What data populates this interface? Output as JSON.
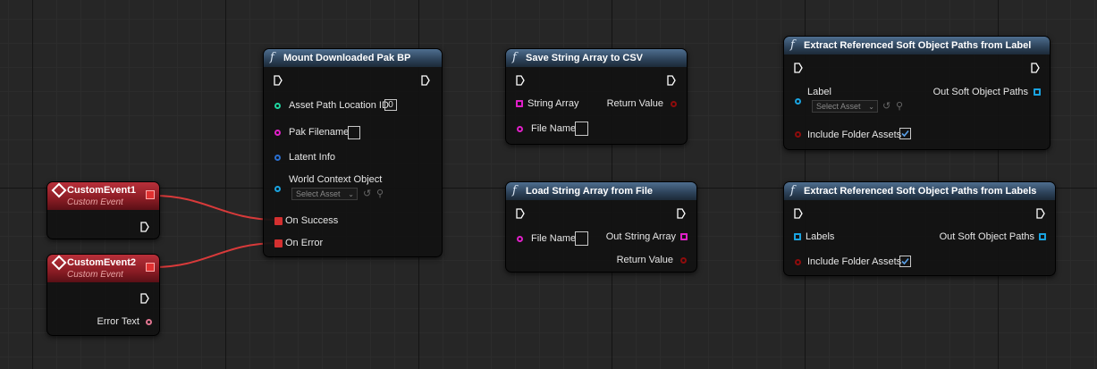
{
  "nodes": {
    "custom_event_1": {
      "title": "CustomEvent1",
      "subtitle": "Custom Event"
    },
    "custom_event_2": {
      "title": "CustomEvent2",
      "subtitle": "Custom Event",
      "error_text": "Error Text"
    },
    "mount_pak": {
      "title": "Mount Downloaded Pak BP",
      "asset_path_location_id": "Asset Path Location ID",
      "asset_path_location_value": "0",
      "pak_filename": "Pak Filename",
      "latent_info": "Latent Info",
      "world_context_object": "World Context Object",
      "select_asset": "Select Asset",
      "on_success": "On Success",
      "on_error": "On Error"
    },
    "save_csv": {
      "title": "Save String Array to CSV",
      "string_array": "String Array",
      "return_value": "Return Value",
      "file_name": "File Name"
    },
    "load_file": {
      "title": "Load String Array from File",
      "file_name": "File Name",
      "out_string_array": "Out String Array",
      "return_value": "Return Value"
    },
    "extract_label": {
      "title": "Extract Referenced Soft Object Paths from Label",
      "label": "Label",
      "select_asset": "Select Asset",
      "out_soft_object_paths": "Out Soft Object Paths",
      "include_folder_assets": "Include Folder Assets",
      "include_folder_assets_checked": true
    },
    "extract_labels": {
      "title": "Extract Referenced Soft Object Paths from Labels",
      "labels": "Labels",
      "out_soft_object_paths": "Out Soft Object Paths",
      "include_folder_assets": "Include Folder Assets",
      "include_folder_assets_checked": true
    }
  },
  "colors": {
    "exec": "#ffffff",
    "int_pin": "#1fd6a0",
    "string_pin": "#e020c8",
    "struct_pin": "#2a6fd0",
    "object_pin": "#1aa3e0",
    "bool_pin": "#8e0c0c",
    "text_pin": "#e07590",
    "delegate": "#e03030",
    "wire": "#d83a3a"
  },
  "icons": {
    "function": "function-f-icon",
    "event": "event-diamond-icon",
    "exec": "exec-arrow-icon",
    "browse": "browse-arrow-icon",
    "search": "search-icon"
  }
}
